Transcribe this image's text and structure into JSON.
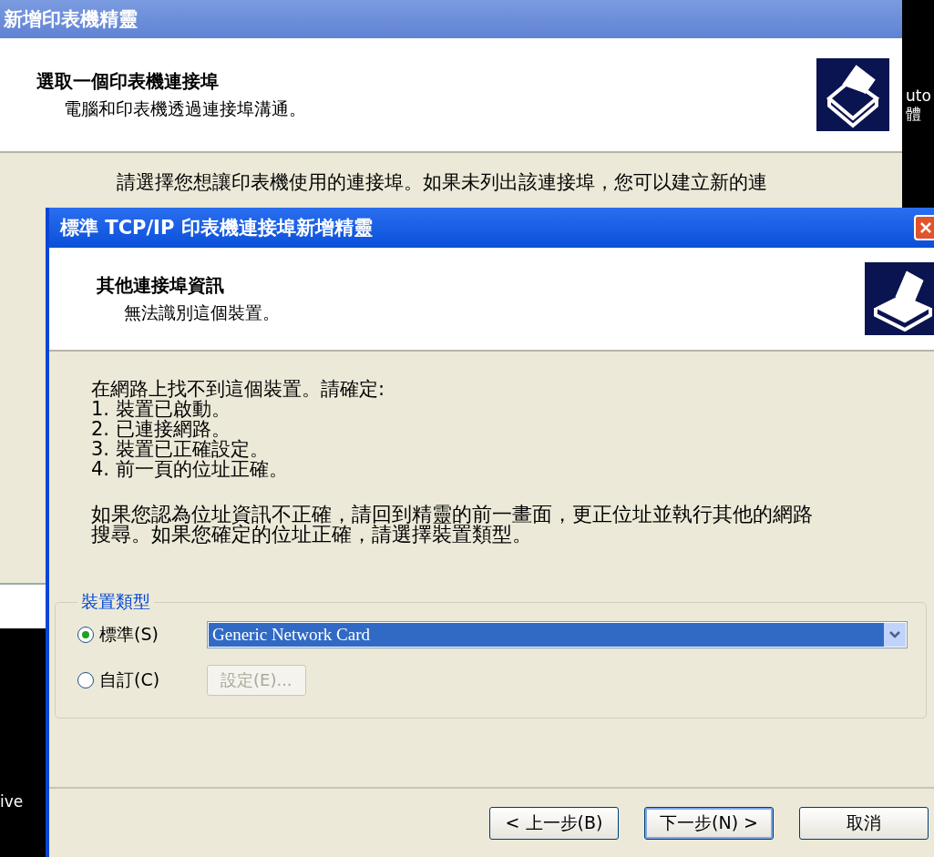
{
  "background_window": {
    "title": "新增印表機精靈",
    "header_title": "選取一個印表機連接埠",
    "header_subtitle": "電腦和印表機透過連接埠溝通。",
    "body_text": "請選擇您想讓印表機使用的連接埠。如果未列出該連接埠，您可以建立新的連"
  },
  "desktop": {
    "icon_labels": [
      "uto",
      "體"
    ],
    "taskbar_text": "ive"
  },
  "dialog": {
    "title": "標準 TCP/IP 印表機連接埠新增精靈",
    "header_title": "其他連接埠資訊",
    "header_subtitle": "無法識別這個裝置。",
    "intro": "在網路上找不到這個裝置。請確定:",
    "checklist": [
      "1. 裝置已啟動。",
      "2. 已連接網路。",
      "3. 裝置已正確設定。",
      "4. 前一頁的位址正確。"
    ],
    "advice": "如果您認為位址資訊不正確，請回到精靈的前一畫面，更正位址並執行其他的網路搜尋。如果您確定的位址正確，請選擇裝置類型。",
    "device_type": {
      "legend": "裝置類型",
      "options": [
        {
          "label": "標準(S)",
          "selected": true
        },
        {
          "label": "自訂(C)",
          "selected": false
        }
      ],
      "select": {
        "value": "Generic Network Card"
      },
      "settings_button": {
        "label": "設定(E)...",
        "disabled": true
      }
    },
    "buttons": [
      {
        "label": "< 上一步(B)",
        "default": false
      },
      {
        "label": "下一步(N) >",
        "default": true
      },
      {
        "label": "取消",
        "default": false
      }
    ]
  }
}
